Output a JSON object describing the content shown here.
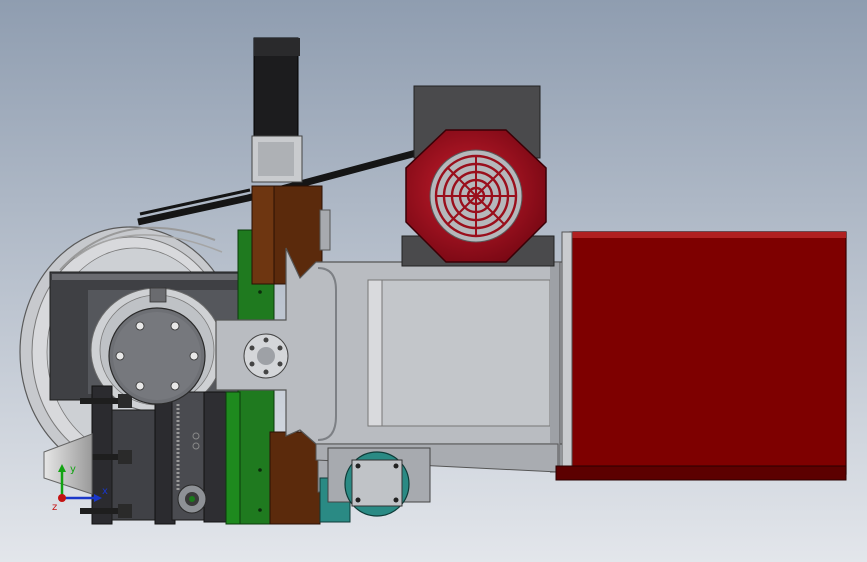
{
  "viewport": {
    "background_top": "#8f9db0",
    "background_bottom": "#e3e6eb"
  },
  "colors": {
    "burner_red": "#7e0000",
    "burner_red_dark": "#5c0000",
    "fan_red": "#9a0f1c",
    "motor_mount": "#4a4a4c",
    "steel": "#b9bcc1",
    "steel_dark": "#8e9196",
    "steel_light": "#d9dadd",
    "bracket_brown": "#5b2a0c",
    "bracket_green": "#1f7a1f",
    "dark_plate": "#2d2d31",
    "hub_gray": "#6e7075",
    "teal_part": "#2a8a84",
    "sensor_black": "#1c1c1e",
    "belt": "#151515"
  },
  "triad": {
    "x_label": "x",
    "y_label": "y",
    "z_label": "z",
    "x_color": "#1a37c9",
    "y_color": "#12a312",
    "z_color": "#c41212"
  }
}
